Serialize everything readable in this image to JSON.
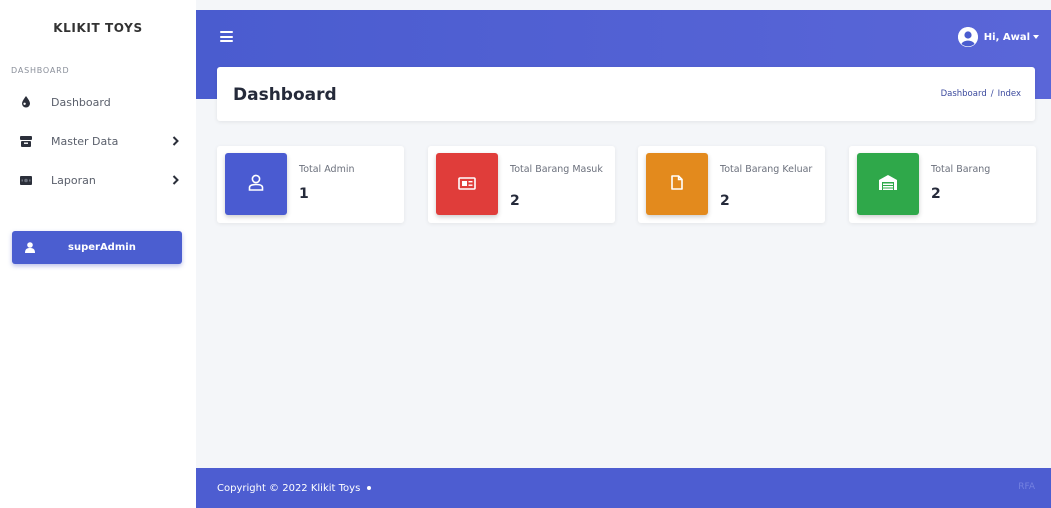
{
  "sidebar": {
    "brand": "KLIKIT TOYS",
    "heading": "DASHBOARD",
    "items": [
      {
        "label": "Dashboard",
        "icon": "droplet-icon",
        "has_submenu": false
      },
      {
        "label": "Master Data",
        "icon": "box-icon",
        "has_submenu": true
      },
      {
        "label": "Laporan",
        "icon": "money-icon",
        "has_submenu": true
      }
    ],
    "user_box": {
      "label": "superAdmin",
      "icon": "user-icon"
    }
  },
  "topbar": {
    "greeting": "Hi, Awal"
  },
  "page": {
    "title": "Dashboard",
    "breadcrumb": [
      "Dashboard",
      "Index"
    ],
    "breadcrumb_separator": "/"
  },
  "stats": [
    {
      "label": "Total Admin",
      "value": "1",
      "color": "#4a5bd1",
      "icon": "user-outline-icon"
    },
    {
      "label": "Total Barang Masuk",
      "value": "2",
      "color": "#e03d3a",
      "icon": "newspaper-icon"
    },
    {
      "label": "Total Barang Keluar",
      "value": "2",
      "color": "#e38a1d",
      "icon": "file-icon"
    },
    {
      "label": "Total Barang",
      "value": "2",
      "color": "#2fa84a",
      "icon": "warehouse-icon"
    }
  ],
  "footer": {
    "copyright": "Copyright © 2022 Klikit Toys",
    "right_text": "RFA"
  },
  "colors": {
    "primary": "#4d5dd1",
    "background": "#f4f6f9"
  }
}
